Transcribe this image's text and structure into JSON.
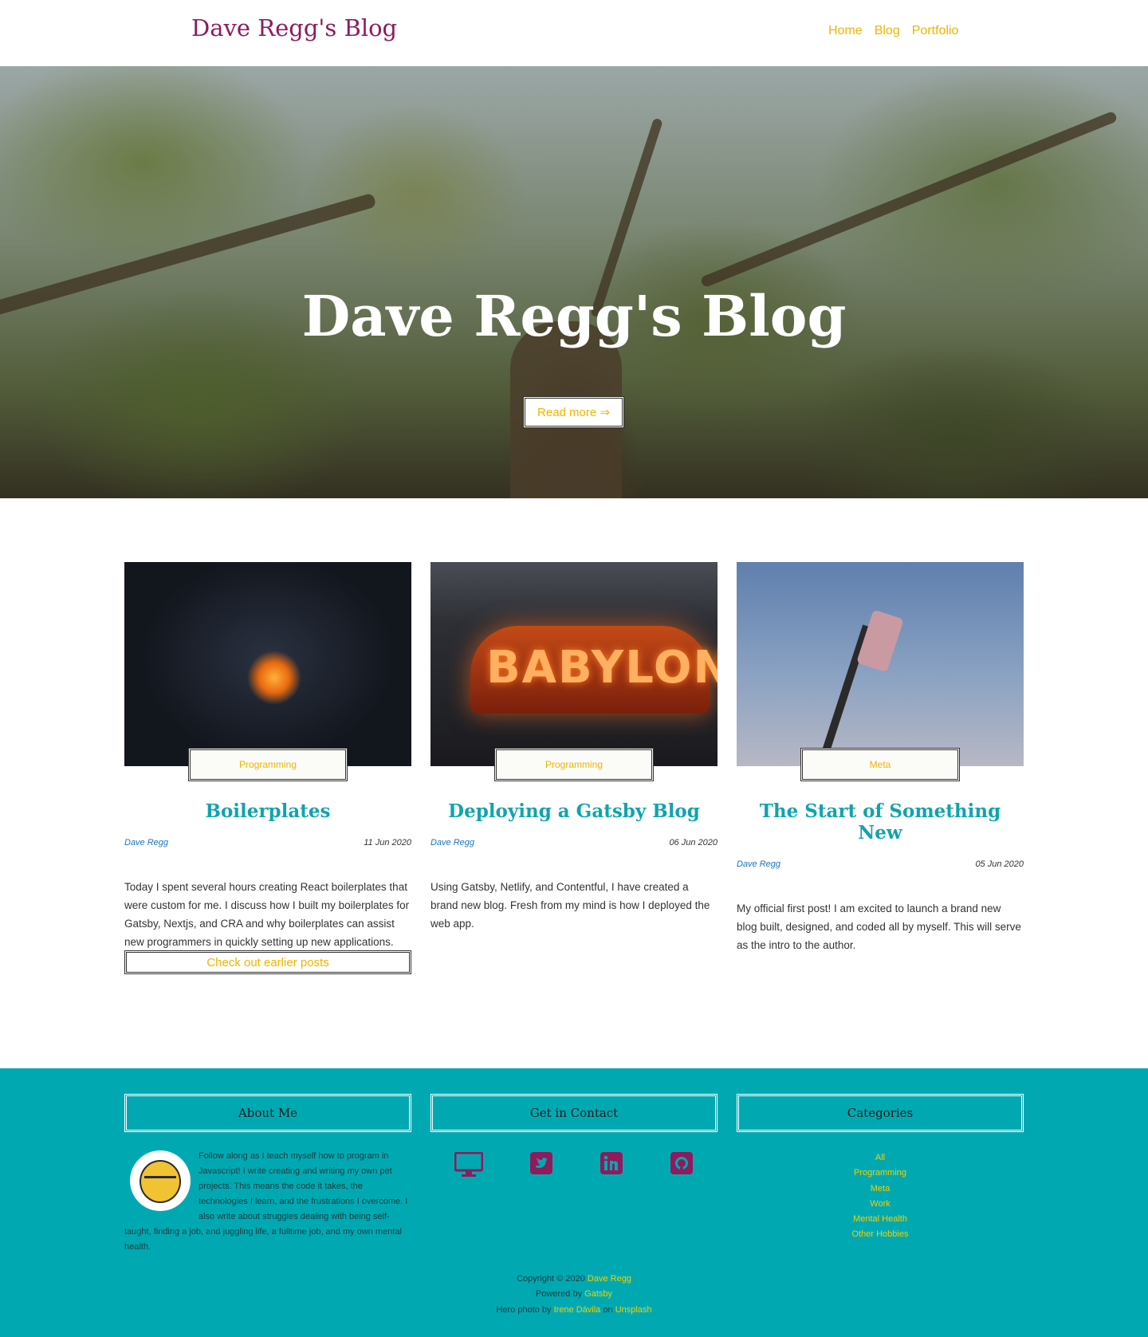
{
  "header": {
    "brand": "Dave Regg's Blog",
    "nav": [
      "Home",
      "Blog",
      "Portfolio"
    ]
  },
  "hero": {
    "title": "Dave Regg's Blog",
    "button": "Read more ⇒"
  },
  "posts": [
    {
      "tag": "Programming",
      "title": "Boilerplates",
      "author": "Dave Regg",
      "date": "11 Jun 2020",
      "excerpt": "Today I spent several hours creating React boilerplates that were custom for me. I discuss how I built my boilerplates for Gatsby, Nextjs, and CRA and why boilerplates can assist new programmers in quickly setting up new applications."
    },
    {
      "tag": "Programming",
      "title": "Deploying a Gatsby Blog",
      "author": "Dave Regg",
      "date": "06 Jun 2020",
      "excerpt": "Using Gatsby, Netlify, and Contentful, I have created a brand new blog. Fresh from my mind is how I deployed the web app.",
      "image_text": "BABYLON"
    },
    {
      "tag": "Meta",
      "title": "The Start of Something New",
      "author": "Dave Regg",
      "date": "05 Jun 2020",
      "excerpt": "My official first post! I am excited to launch a brand new blog built, designed, and coded all by myself. This will serve as the intro to the author."
    }
  ],
  "earlier_button": "Check out earlier posts",
  "footer": {
    "about_title": "About Me",
    "about_text": "Follow along as I teach myself how to program in Javascript! I write creating and writing my own pet projects. This means the code it takes, the technologies I learn, and the frustrations I overcome. I also write about struggles dealing with being self-taught, finding a job, and juggling life, a fulltime job, and my own mental health.",
    "contact_title": "Get in Contact",
    "contact_icons": [
      "monitor-icon",
      "twitter-icon",
      "linkedin-icon",
      "github-icon"
    ],
    "categories_title": "Categories",
    "categories": [
      "All",
      "Programming",
      "Meta",
      "Work",
      "Mental Health",
      "Other Hobbies"
    ],
    "credits": {
      "copyright_prefix": "Copyright © 2020",
      "copyright_name": "Dave Regg",
      "powered_prefix": "Powered by",
      "powered_name": "Gatsby",
      "photo_prefix": "Hero photo by",
      "photo_author": "Irene Dávila",
      "photo_on": "on",
      "photo_site": "Unsplash"
    }
  },
  "colors": {
    "brand": "#8e1b5c",
    "accent": "#f0b400",
    "title_teal": "#10a4ad",
    "footer_bg": "#00a9b2"
  }
}
